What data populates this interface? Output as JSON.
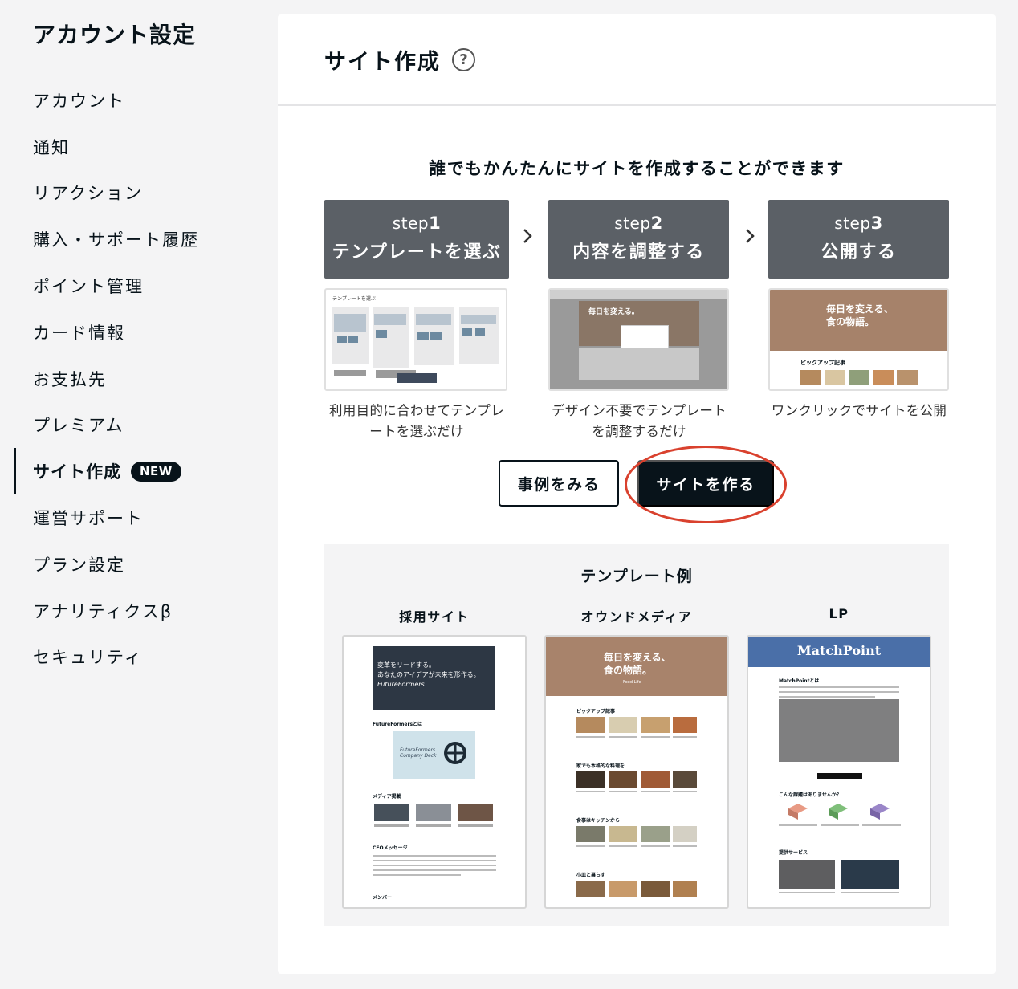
{
  "sidebar": {
    "title": "アカウント設定",
    "items": [
      {
        "label": "アカウント"
      },
      {
        "label": "通知"
      },
      {
        "label": "リアクション"
      },
      {
        "label": "購入・サポート履歴"
      },
      {
        "label": "ポイント管理"
      },
      {
        "label": "カード情報"
      },
      {
        "label": "お支払先"
      },
      {
        "label": "プレミアム"
      },
      {
        "label": "サイト作成",
        "badge": "NEW",
        "active": true
      },
      {
        "label": "運営サポート"
      },
      {
        "label": "プラン設定"
      },
      {
        "label": "アナリティクスβ"
      },
      {
        "label": "セキュリティ"
      }
    ]
  },
  "main": {
    "title": "サイト作成",
    "help_icon": "question-circle-icon",
    "headline": "誰でもかんたんにサイトを作成することができます",
    "steps": [
      {
        "prefix": "step",
        "number": "1",
        "title": "テンプレートを選ぶ",
        "desc_line1": "利用目的に合わせてテンプレ",
        "desc_line2": "ートを選ぶだけ"
      },
      {
        "prefix": "step",
        "number": "2",
        "title": "内容を調整する",
        "desc_line1": "デザイン不要でテンプレート",
        "desc_line2": "を調整するだけ"
      },
      {
        "prefix": "step",
        "number": "3",
        "title": "公開する",
        "desc_line1": "ワンクリックでサイトを公開",
        "desc_line2": ""
      }
    ],
    "buttons": {
      "examples": "事例をみる",
      "create": "サイトを作る"
    },
    "template_examples": {
      "title": "テンプレート例",
      "items": [
        {
          "label": "採用サイト",
          "hero_line1": "変革をリードする。",
          "hero_line2": "あなたのアイデアが未来を形作る。",
          "brand": "FutureFormers",
          "section1": "FutureFormersとは",
          "deck_line1": "FutureFormers",
          "deck_line2": "Company Deck",
          "section2": "メディア掲載",
          "section3": "CEOメッセージ",
          "section4": "メンバー"
        },
        {
          "label": "オウンドメディア",
          "hero_line1": "毎日を変える、",
          "hero_line2": "食の物語。",
          "brand": "Food Life",
          "section1": "ピックアップ記事",
          "section2": "家でも本格的な料理を",
          "section3": "食事はキッチンから",
          "section4": "小皿と暮らす"
        },
        {
          "label": "LP",
          "brand": "MatchPoint",
          "section1": "MatchPointとは",
          "section2": "こんな課題はありませんか？",
          "section3": "提供サービス"
        }
      ]
    },
    "thumb2_hero": "毎日を変える。",
    "thumb3_hero_line1": "毎日を変える、",
    "thumb3_hero_line2": "食の物語。",
    "thumb3_section": "ピックアップ記事",
    "thumb1_header": "テンプレートを選ぶ"
  }
}
